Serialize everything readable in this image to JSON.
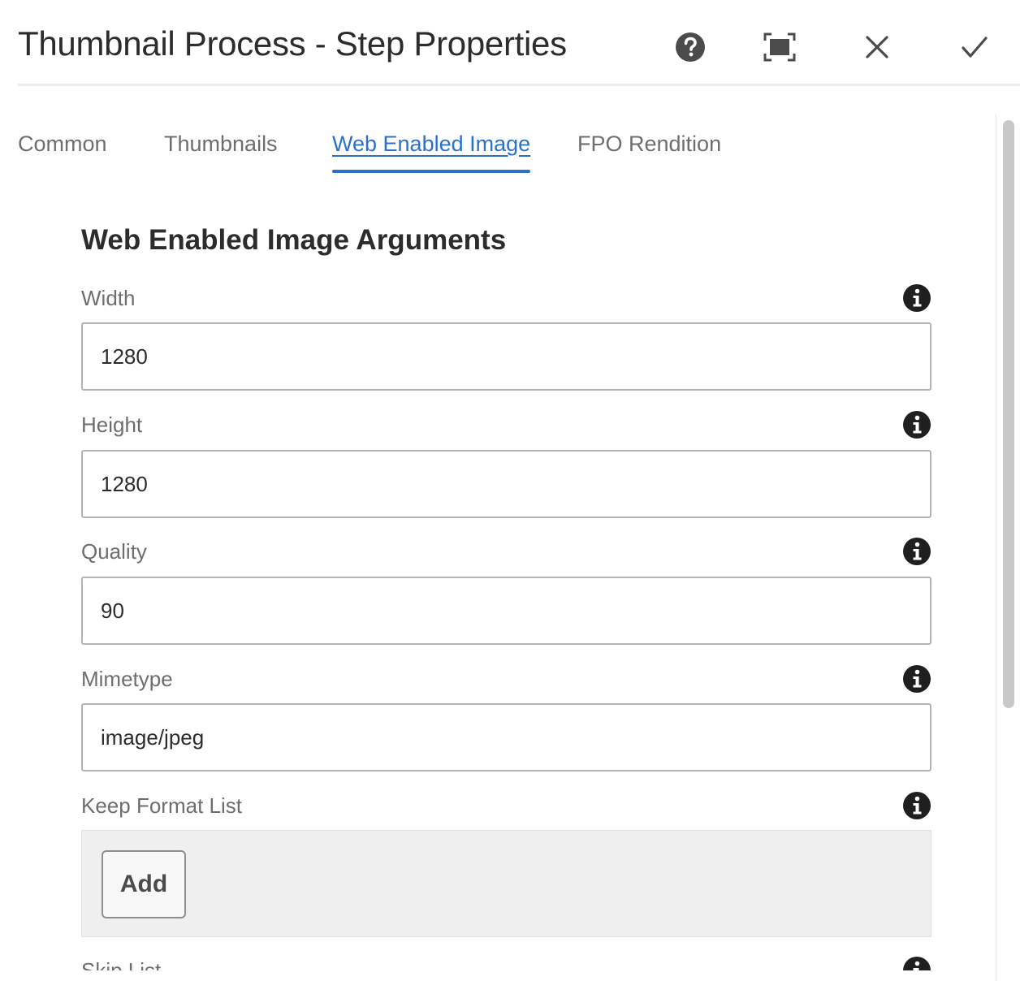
{
  "dialog": {
    "title": "Thumbnail Process - Step Properties",
    "actions": {
      "help": "help-icon",
      "fullscreen": "fullscreen-icon",
      "close": "close-icon",
      "done": "checkmark-icon"
    }
  },
  "tabs": [
    {
      "label": "Common",
      "active": false
    },
    {
      "label": "Thumbnails",
      "active": false
    },
    {
      "label": "Web Enabled Image",
      "active": true
    },
    {
      "label": "FPO Rendition",
      "active": false
    }
  ],
  "section": {
    "title": "Web Enabled Image Arguments",
    "fields": [
      {
        "label": "Width",
        "value": "1280"
      },
      {
        "label": "Height",
        "value": "1280"
      },
      {
        "label": "Quality",
        "value": "90"
      },
      {
        "label": "Mimetype",
        "value": "image/jpeg"
      }
    ],
    "keep_format_list": {
      "label": "Keep Format List",
      "add_label": "Add"
    },
    "skip_list": {
      "label": "Skip List"
    }
  },
  "colors": {
    "accent": "#2c71c9",
    "icon": "#4b4b4b",
    "info_icon": "#1f1f1f"
  }
}
